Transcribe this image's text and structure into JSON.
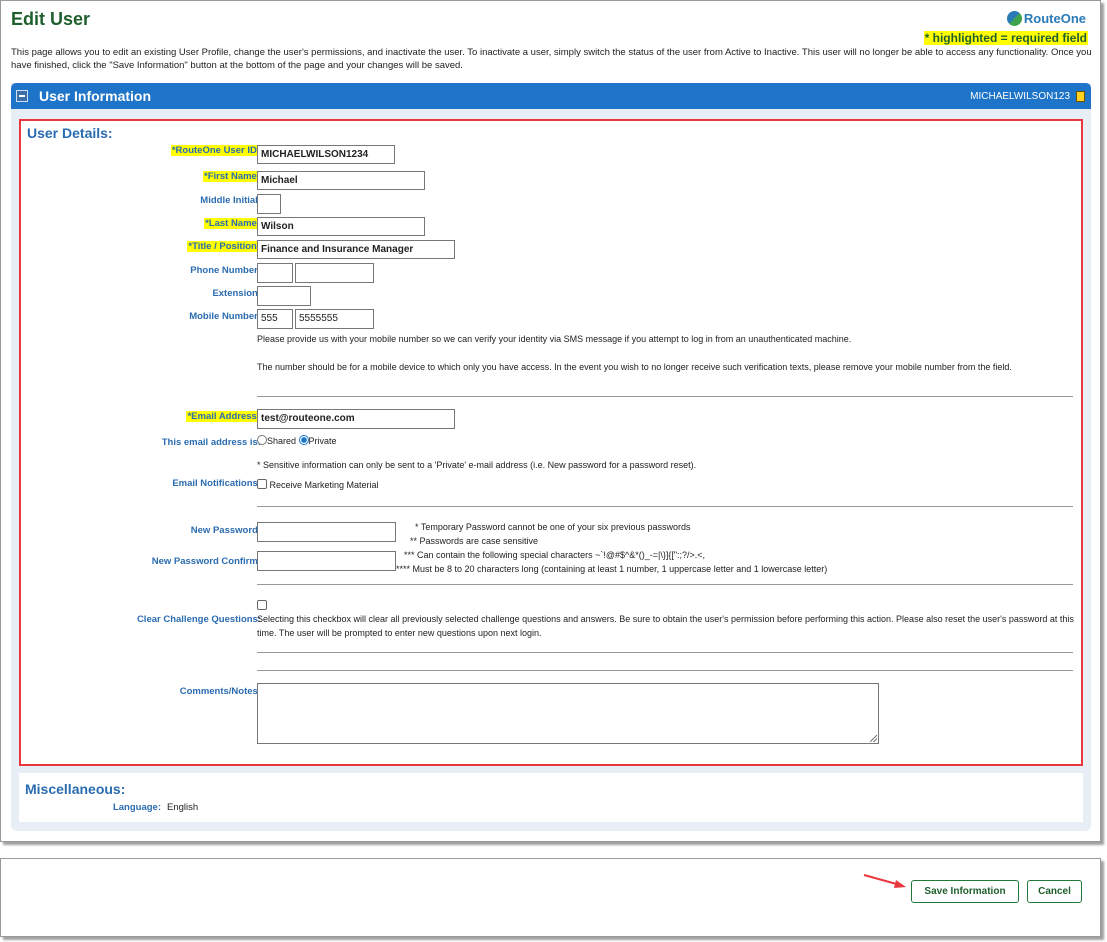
{
  "page": {
    "title": "Edit User",
    "logo_text": "RouteOne",
    "required_legend": "* highlighted = required field",
    "intro_text": "This page allows you to edit an existing User Profile, change the user's permissions, and inactivate the user. To inactivate a user, simply switch the status of the user from Active to Inactive. This user will no longer be able to access any functionality. Once you have finished, click the \"Save Information\" button at the bottom of the page and your changes will be saved."
  },
  "panel": {
    "title": "User Information",
    "user_id_display": "MICHAELWILSON123",
    "icons": {
      "collapse": "collapse-minus-icon",
      "document": "document-icon"
    }
  },
  "user_details": {
    "section_title": "User Details:",
    "fields": {
      "user_id": {
        "label": "*RouteOne User ID:",
        "value": "MICHAELWILSON1234",
        "required": true
      },
      "first_name": {
        "label": "*First Name:",
        "value": "Michael",
        "required": true
      },
      "middle_initial": {
        "label": "Middle Initial:",
        "value": ""
      },
      "last_name": {
        "label": "*Last Name:",
        "value": "Wilson",
        "required": true
      },
      "title_position": {
        "label": "*Title / Position:",
        "value": "Finance and Insurance Manager",
        "required": true
      },
      "phone_number": {
        "label": "Phone Number:",
        "area": "",
        "number": ""
      },
      "extension": {
        "label": "Extension:",
        "value": ""
      },
      "mobile_number": {
        "label": "Mobile Number:",
        "area": "555",
        "number": "5555555"
      },
      "email_address": {
        "label": "*Email Address:",
        "value": "test@routeone.com",
        "required": true
      },
      "email_type": {
        "label": "This email address is:",
        "options": [
          "Shared",
          "Private"
        ],
        "selected": "Private"
      },
      "email_notifications": {
        "label": "Email Notifications:",
        "checkbox_label": "Receive Marketing Material",
        "checked": false
      },
      "new_password": {
        "label": "New Password:",
        "value": ""
      },
      "new_password_confirm": {
        "label": "New Password Confirm:",
        "value": ""
      },
      "clear_challenge": {
        "label": "Clear Challenge Questions:",
        "checked": false
      },
      "comments": {
        "label": "Comments/Notes:",
        "value": ""
      }
    },
    "notes": {
      "mobile_1": "Please provide us with your mobile number so we can verify your identity via SMS message if you attempt to log in from an unauthenticated machine.",
      "mobile_2": "The number should be for a mobile device to which only you have access. In the event you wish to no longer receive such verification texts, please remove your mobile number from the field.",
      "email_sensitive": "* Sensitive information can only be sent to a 'Private' e-mail address (i.e. New password for a password reset).",
      "pw_rule_1": "* Temporary Password cannot be one of your six previous passwords",
      "pw_rule_2": "** Passwords are case sensitive",
      "pw_rule_3": "*** Can contain the following special characters ~`!@#$^&*()_-=|\\}]{[\":;?/>.<,",
      "pw_rule_4": "**** Must be 8 to 20 characters long (containing at least 1 number, 1 uppercase letter and 1 lowercase letter)",
      "challenge": "Selecting this checkbox will clear all previously selected challenge questions and answers. Be sure to obtain the user's permission before performing this action. Please also reset the user's password at this time. The user will be prompted to enter new questions upon next login."
    }
  },
  "misc": {
    "section_title": "Miscellaneous:",
    "language_label": "Language:",
    "language_value": "English"
  },
  "footer": {
    "save_label": "Save Information",
    "cancel_label": "Cancel"
  },
  "colors": {
    "accent_blue": "#1e74c8",
    "brand_green": "#1f5f2e",
    "highlight_yellow": "#ffff00",
    "callout_red": "#e8383d"
  }
}
